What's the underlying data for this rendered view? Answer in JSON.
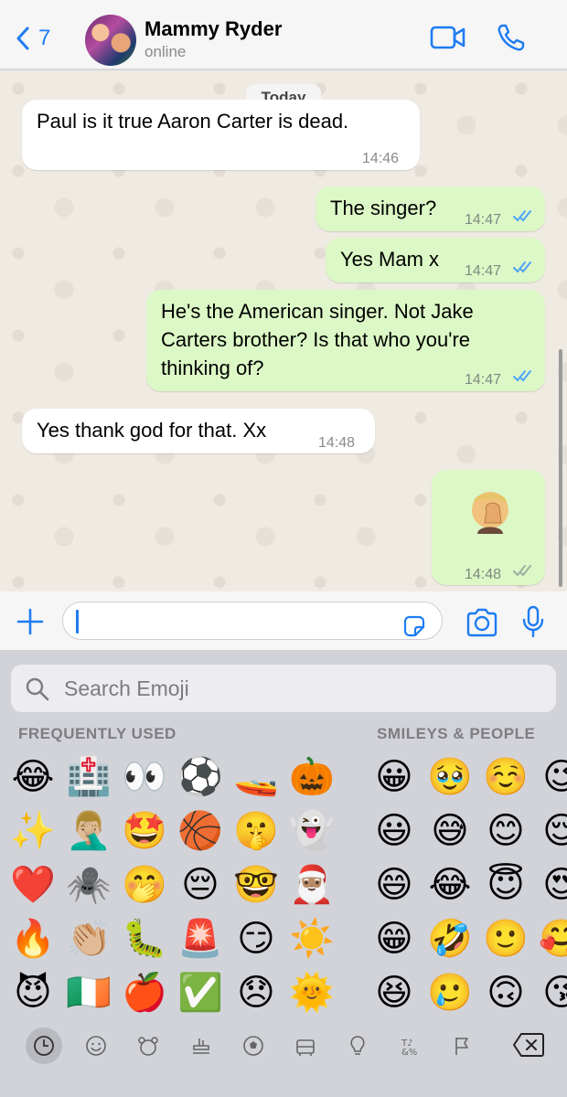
{
  "header": {
    "back_count": "7",
    "contact_name": "Mammy Ryder",
    "status": "online"
  },
  "chat": {
    "date_label": "Today",
    "messages": [
      {
        "direction": "in",
        "text": "Paul is it true Aaron Carter is dead.",
        "time": "14:46"
      },
      {
        "direction": "out",
        "text": "The singer?",
        "time": "14:47",
        "status": "read"
      },
      {
        "direction": "out",
        "text": "Yes Mam x",
        "time": "14:47",
        "status": "read"
      },
      {
        "direction": "out",
        "text_lines": [
          "He's the American singer. Not Jake",
          "Carters brother? Is that who you're",
          "thinking of?"
        ],
        "time": "14:47",
        "status": "read"
      },
      {
        "direction": "in",
        "text": "Yes thank god for that. Xx",
        "time": "14:48"
      },
      {
        "direction": "out",
        "emoji": "facepalm",
        "time": "14:48",
        "status": "delivered"
      }
    ]
  },
  "composer": {
    "value": "",
    "icons": [
      "plus-icon",
      "sticker-icon",
      "camera-icon",
      "microphone-icon"
    ]
  },
  "keyboard": {
    "search_placeholder": "Search Emoji",
    "frequently_used_label": "FREQUENTLY USED",
    "smileys_label": "SMILEYS & PEOPLE",
    "frequently_used": [
      [
        "😂",
        "🏥",
        "👀",
        "⚽",
        "🚤",
        "🎃"
      ],
      [
        "✨",
        "🤦🏼‍♂️",
        "🤩",
        "🏀",
        "🤫",
        "👻"
      ],
      [
        "❤️",
        "🕷️",
        "🤭",
        "😔",
        "🤓",
        "🎅🏽"
      ],
      [
        "🔥",
        "👏🏼",
        "🐛",
        "🚨",
        "😏",
        "☀️"
      ],
      [
        "😈",
        "🇮🇪",
        "🍎",
        "✅",
        "😞",
        "🌞"
      ]
    ],
    "smileys": [
      [
        "😀",
        "🥹",
        "☺️",
        "😉"
      ],
      [
        "😃",
        "😅",
        "😊",
        "😌"
      ],
      [
        "😄",
        "😂",
        "😇",
        "😍"
      ],
      [
        "😁",
        "🤣",
        "🙂",
        "🥰"
      ],
      [
        "😆",
        "🥲",
        "🙃",
        "😘"
      ]
    ],
    "categories": [
      "recent-icon",
      "smileys-icon",
      "animals-icon",
      "food-icon",
      "activity-icon",
      "travel-icon",
      "objects-icon",
      "symbols-icon",
      "flags-icon"
    ],
    "active_category": "recent-icon"
  },
  "colors": {
    "accent": "#1e7cf2",
    "outgoing_bubble": "#dcf8c6",
    "incoming_bubble": "#ffffff",
    "read_ticks": "#4fa3f7",
    "delivered_ticks": "#9bb0a0"
  }
}
